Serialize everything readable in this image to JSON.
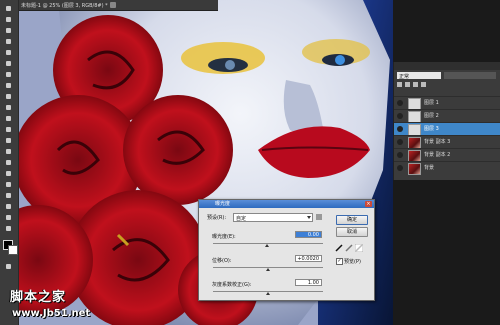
{
  "document": {
    "tab_title": "未标题-1 @ 25% (图层 3, RGB/8#) *"
  },
  "layers_panel": {
    "tab_label": "正常",
    "rows": [
      {
        "name": "图层 1",
        "selected": false,
        "thumb": "plain"
      },
      {
        "name": "图层 2",
        "selected": false,
        "thumb": "plain"
      },
      {
        "name": "图层 3",
        "selected": true,
        "thumb": "plain"
      },
      {
        "name": "背景 副本 3",
        "selected": false,
        "thumb": "photo"
      },
      {
        "name": "背景 副本 2",
        "selected": false,
        "thumb": "photo"
      },
      {
        "name": "背景",
        "selected": false,
        "thumb": "photo"
      }
    ]
  },
  "dialog": {
    "title": "曝光度",
    "preset_label": "预设(R):",
    "preset_value": "自定",
    "exposure_label": "曝光度(E):",
    "exposure_value": "0.00",
    "offset_label": "位移(O):",
    "offset_value": "+0.0020",
    "gamma_label": "灰度系数校正(G):",
    "gamma_value": "1.00",
    "ok_label": "确定",
    "cancel_label": "取消",
    "preview_label": "预览(P)",
    "preview_checked": true
  },
  "watermark": {
    "title": "脚本之家",
    "url": "www.Jb51.net"
  }
}
